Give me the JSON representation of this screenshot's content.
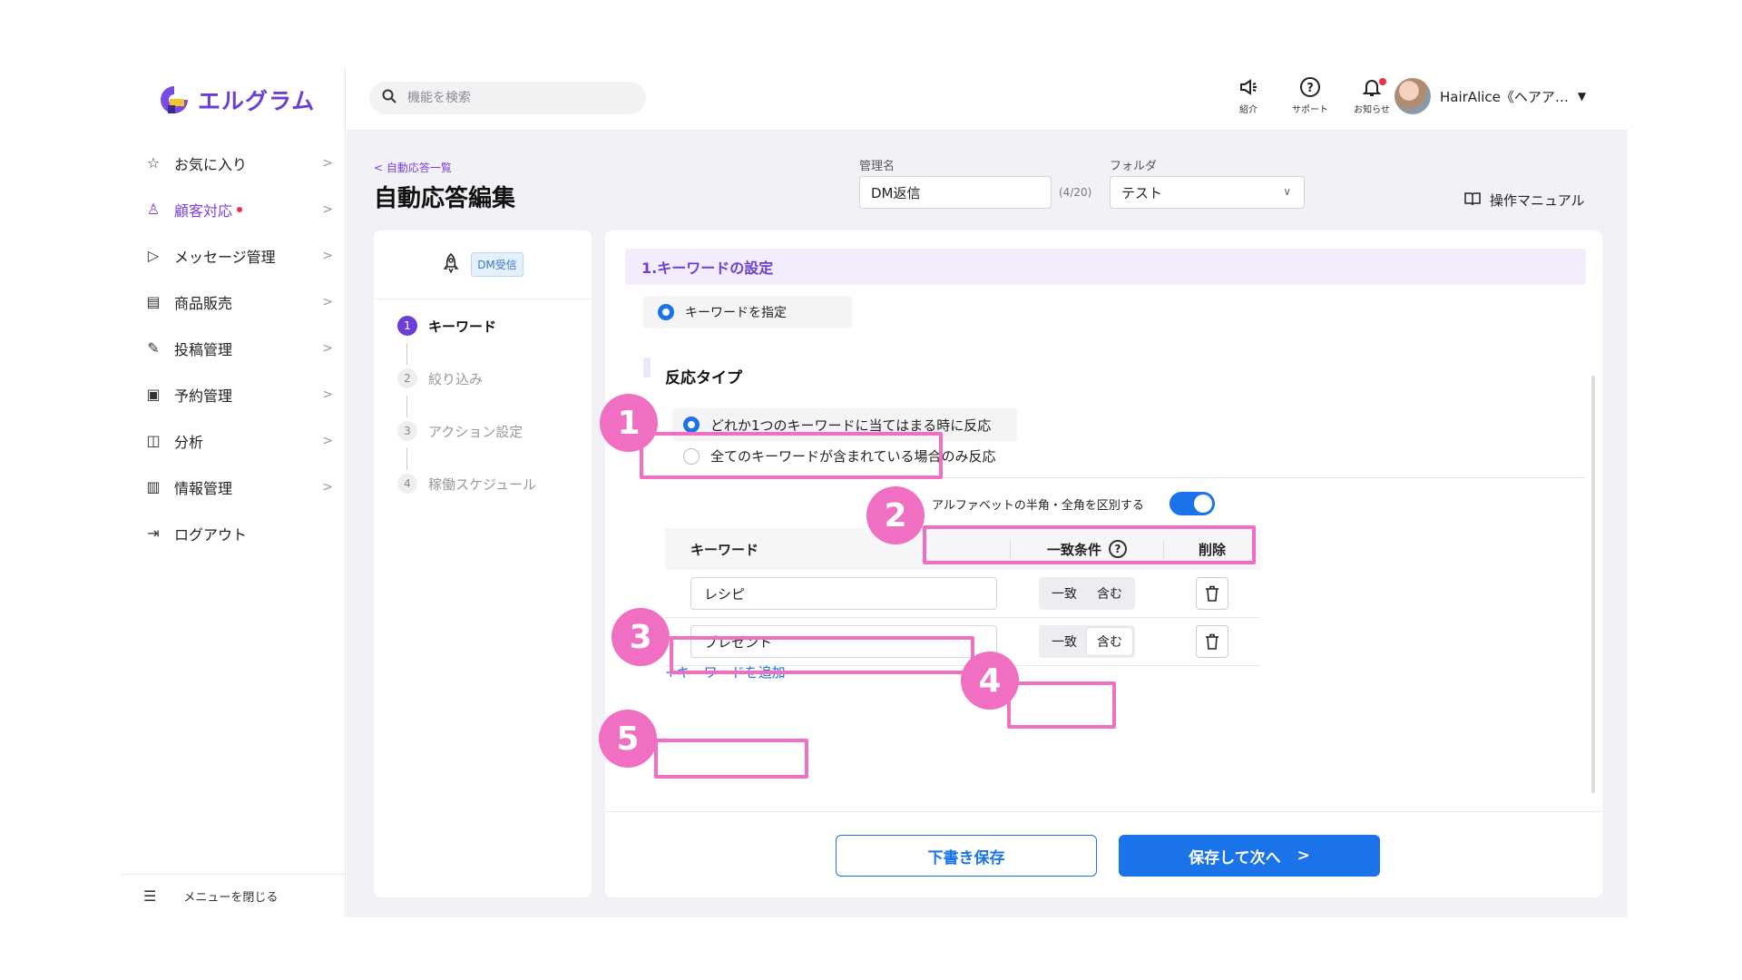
{
  "logo": {
    "text": "エルグラム"
  },
  "sidebar": {
    "items": [
      {
        "icon": "☆",
        "label": "お気に入り",
        "name": "favorites"
      },
      {
        "icon": "♙",
        "label": "顧客対応",
        "name": "customer-support",
        "active": true,
        "dot": true
      },
      {
        "icon": "▷",
        "label": "メッセージ管理",
        "name": "message-management"
      },
      {
        "icon": "▤",
        "label": "商品販売",
        "name": "product-sales"
      },
      {
        "icon": "✎",
        "label": "投稿管理",
        "name": "post-management"
      },
      {
        "icon": "▣",
        "label": "予約管理",
        "name": "reservation-management"
      },
      {
        "icon": "◫",
        "label": "分析",
        "name": "analysis"
      },
      {
        "icon": "▥",
        "label": "情報管理",
        "name": "information-management"
      },
      {
        "icon": "⇥",
        "label": "ログアウト",
        "name": "logout",
        "no_chevron": true
      }
    ],
    "close_menu": "メニューを閉じる"
  },
  "search": {
    "placeholder": "機能を検索"
  },
  "header": {
    "tools": [
      {
        "label": "紹介",
        "icon": "megaphone-icon"
      },
      {
        "label": "サポート",
        "icon": "help-icon"
      },
      {
        "label": "お知らせ",
        "icon": "bell-icon",
        "badge": true
      }
    ],
    "user_name": "HairAlice《ヘアア…"
  },
  "page": {
    "breadcrumb": "< 自動応答一覧",
    "title": "自動応答編集",
    "name_label": "管理名",
    "name_value": "DM返信",
    "name_counter": "(4/20)",
    "folder_label": "フォルダ",
    "folder_value": "テスト",
    "manual": "操作マニュアル"
  },
  "steps": {
    "trigger_tag": "DM受信",
    "items": [
      {
        "num": "1",
        "label": "キーワード",
        "active": true
      },
      {
        "num": "2",
        "label": "絞り込み"
      },
      {
        "num": "3",
        "label": "アクション設定"
      },
      {
        "num": "4",
        "label": "稼働スケジュール"
      }
    ]
  },
  "section": {
    "title": "1.キーワードの設定",
    "keyword_mode": "キーワードを指定",
    "reaction_title": "反応タイプ",
    "option_any": "どれか1つのキーワードに当てはまる時に反応",
    "option_all": "全てのキーワードが含まれている場合のみ反応",
    "toggle_label": "アルファベットの半角・全角を区別する",
    "toggle_on": true
  },
  "table": {
    "col_keyword": "キーワード",
    "col_condition": "一致条件",
    "col_delete": "削除",
    "rows": [
      {
        "keyword": "レシピ",
        "exact": "一致",
        "contains": "含む",
        "selected": "none"
      },
      {
        "keyword": "プレゼント",
        "exact": "一致",
        "contains": "含む",
        "selected": "contains"
      }
    ],
    "add": "+キーワードを追加"
  },
  "buttons": {
    "draft": "下書き保存",
    "next": "保存して次へ"
  },
  "callouts": [
    "1",
    "2",
    "3",
    "4",
    "5"
  ],
  "colors": {
    "accent": "#6b3fd4",
    "primary": "#1a73e8",
    "highlight": "#f06fc3"
  }
}
